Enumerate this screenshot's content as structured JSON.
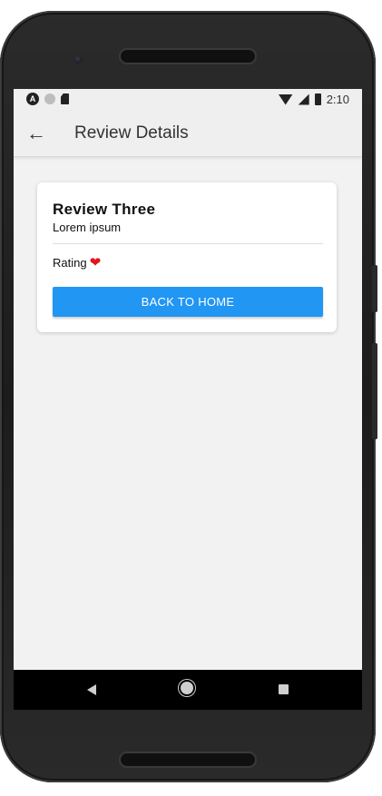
{
  "status_bar": {
    "time": "2:10",
    "left_icons": [
      "accessibility-icon",
      "circle-icon",
      "sd-card-icon"
    ],
    "right_icons": [
      "wifi-icon",
      "signal-icon",
      "battery-icon"
    ]
  },
  "app_bar": {
    "title": "Review Details",
    "back_icon": "←"
  },
  "review": {
    "title": "Review Three",
    "body": "Lorem ipsum",
    "rating_label": "Rating",
    "rating_heart": "❤"
  },
  "actions": {
    "back_to_home": "BACK TO HOME"
  },
  "colors": {
    "primary": "#2196f3",
    "heart": "#e0141c",
    "background": "#f2f2f2"
  }
}
